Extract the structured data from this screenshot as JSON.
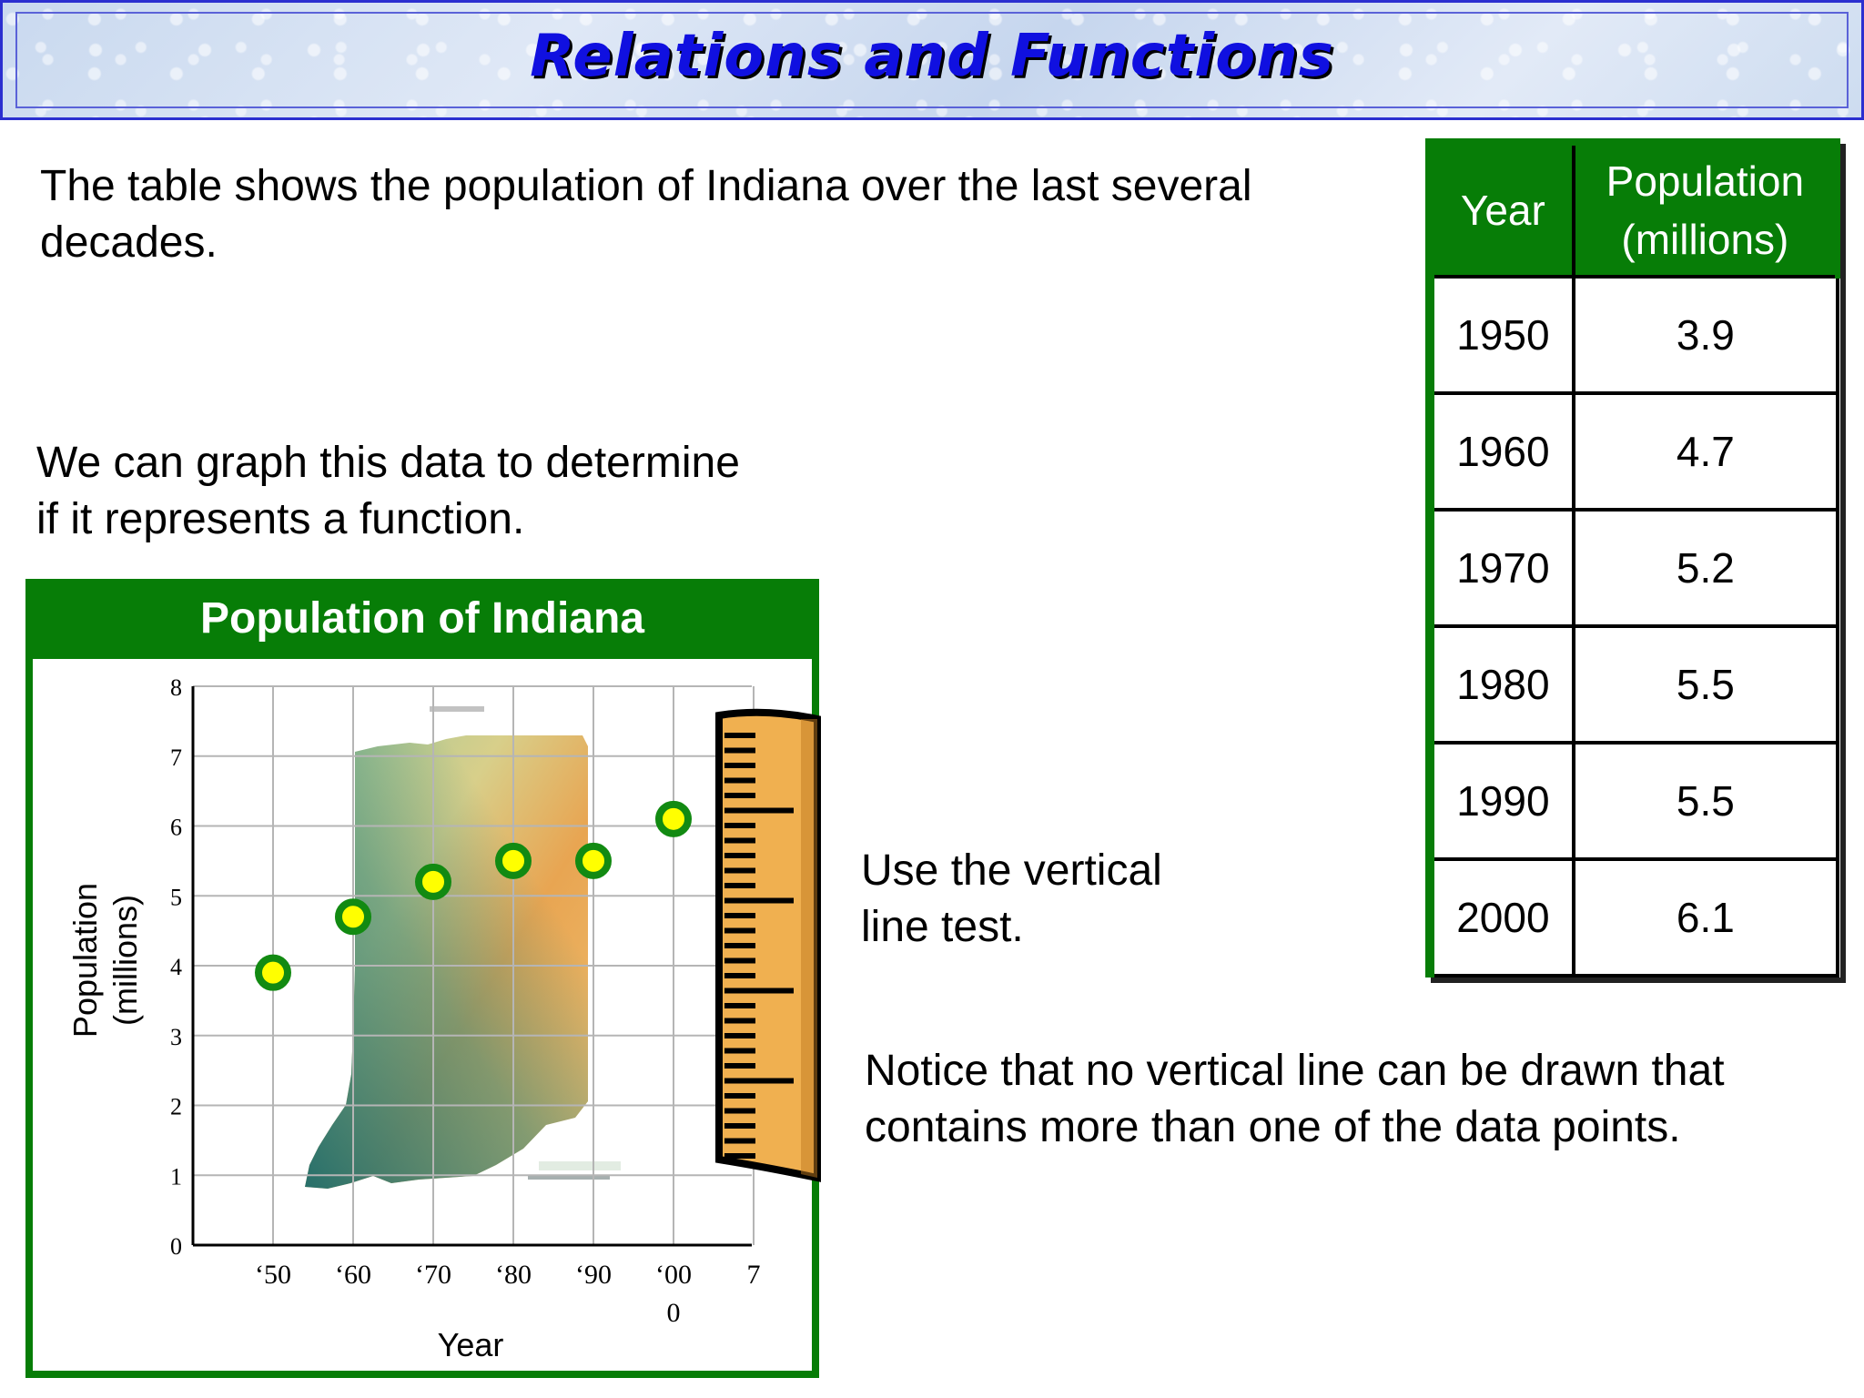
{
  "title": "Relations and Functions",
  "intro_text": "The table shows the population of Indiana over the last several decades.",
  "graph_text": "We can graph this data to determine\nif it represents a function.",
  "vertical_line_text": "Use the vertical\nline test.",
  "notice_text": "Notice that no vertical line can be drawn that\ncontains more than one of the data points.",
  "table": {
    "headers": [
      "Year",
      "Population\n(millions)"
    ],
    "rows": [
      [
        "1950",
        "3.9"
      ],
      [
        "1960",
        "4.7"
      ],
      [
        "1970",
        "5.2"
      ],
      [
        "1980",
        "5.5"
      ],
      [
        "1990",
        "5.5"
      ],
      [
        "2000",
        "6.1"
      ]
    ]
  },
  "colors": {
    "green": "#077d07",
    "point_fill": "#ffff00",
    "point_stroke": "#128a12",
    "title_blue": "#1010e0",
    "ruler": "#f0b050"
  },
  "icons": [
    "indiana-map-image",
    "ruler-icon"
  ],
  "chart_data": {
    "type": "scatter",
    "title": "Population of Indiana",
    "xlabel": "Year",
    "ylabel": "Population\n(millions)",
    "x_tick_labels": [
      "‘50",
      "‘60",
      "‘70",
      "‘80",
      "‘90",
      "‘00\n0",
      "7"
    ],
    "y_tick_labels": [
      "0",
      "1",
      "2",
      "3",
      "4",
      "5",
      "6",
      "7",
      "8"
    ],
    "ylim": [
      0,
      8
    ],
    "grid": true,
    "background_image": "indiana-map-image",
    "x": [
      "‘50",
      "‘60",
      "‘70",
      "‘80",
      "‘90",
      "‘00"
    ],
    "y": [
      3.9,
      4.7,
      5.2,
      5.5,
      5.5,
      6.1
    ]
  }
}
